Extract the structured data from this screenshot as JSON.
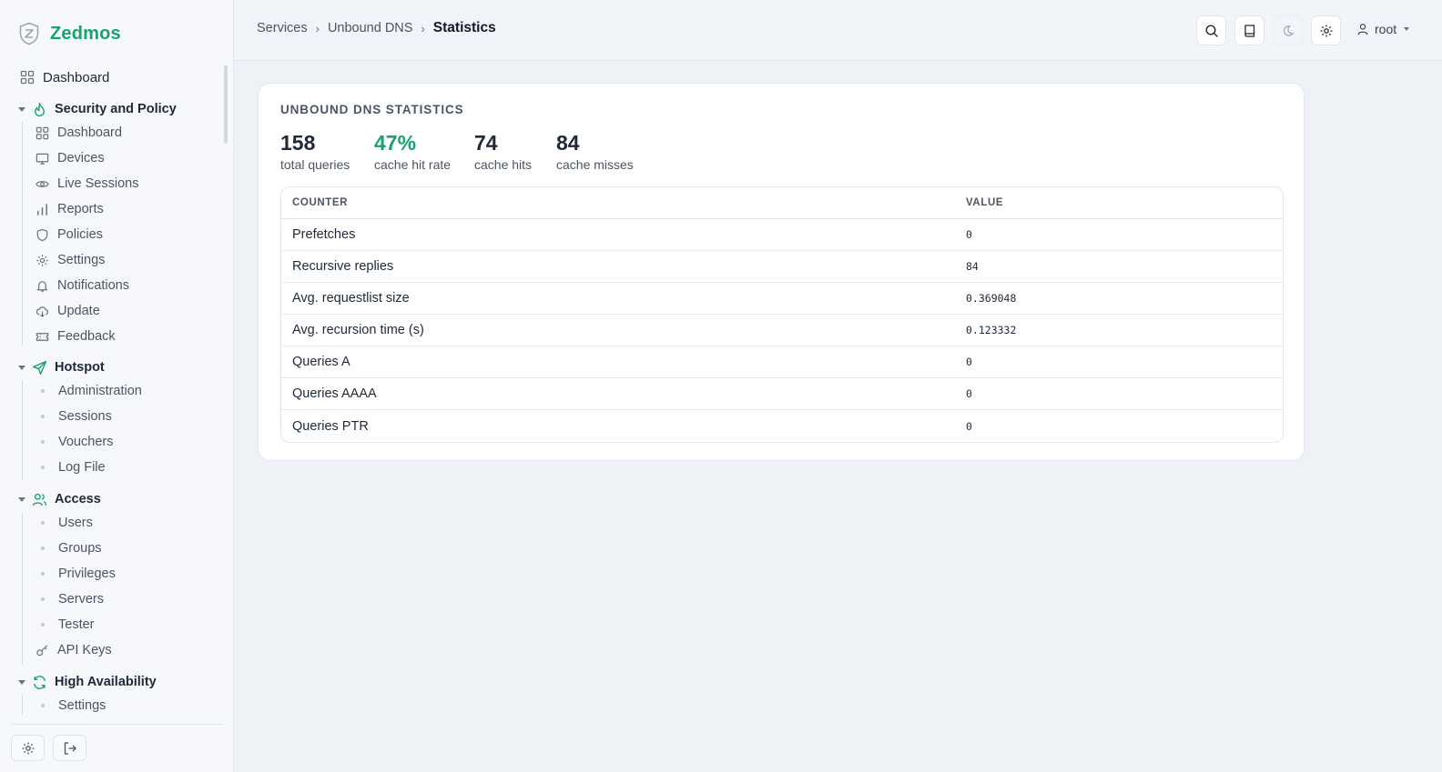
{
  "brand": {
    "name": "Zedmos",
    "color": "#16a36c"
  },
  "sidebar": {
    "dashboard_label": "Dashboard",
    "sections": [
      {
        "label": "Security and Policy",
        "icon": "flame-icon",
        "items": [
          {
            "label": "Dashboard",
            "icon": "grid-icon"
          },
          {
            "label": "Devices",
            "icon": "monitor-icon"
          },
          {
            "label": "Live Sessions",
            "icon": "eye-icon"
          },
          {
            "label": "Reports",
            "icon": "bar-chart-icon"
          },
          {
            "label": "Policies",
            "icon": "shield-icon"
          },
          {
            "label": "Settings",
            "icon": "gear-icon"
          },
          {
            "label": "Notifications",
            "icon": "bell-icon"
          },
          {
            "label": "Update",
            "icon": "cloud-download-icon"
          },
          {
            "label": "Feedback",
            "icon": "ticket-icon"
          }
        ]
      },
      {
        "label": "Hotspot",
        "icon": "send-icon",
        "items": [
          {
            "label": "Administration"
          },
          {
            "label": "Sessions"
          },
          {
            "label": "Vouchers"
          },
          {
            "label": "Log File"
          }
        ]
      },
      {
        "label": "Access",
        "icon": "users-icon",
        "items": [
          {
            "label": "Users"
          },
          {
            "label": "Groups"
          },
          {
            "label": "Privileges"
          },
          {
            "label": "Servers"
          },
          {
            "label": "Tester"
          },
          {
            "label": "API Keys",
            "icon": "key-icon"
          }
        ]
      },
      {
        "label": "High Availability",
        "icon": "refresh-icon",
        "items": [
          {
            "label": "Settings"
          }
        ]
      }
    ]
  },
  "breadcrumb": {
    "items": [
      "Services",
      "Unbound DNS"
    ],
    "current": "Statistics"
  },
  "topbar": {
    "user": "root"
  },
  "card": {
    "title": "UNBOUND DNS STATISTICS",
    "stats": [
      {
        "value": "158",
        "caption": "total queries"
      },
      {
        "value": "47%",
        "caption": "cache hit rate"
      },
      {
        "value": "74",
        "caption": "cache hits"
      },
      {
        "value": "84",
        "caption": "cache misses"
      }
    ],
    "table": {
      "headers": [
        "COUNTER",
        "VALUE"
      ],
      "rows": [
        [
          "Prefetches",
          "0"
        ],
        [
          "Recursive replies",
          "84"
        ],
        [
          "Avg. requestlist size",
          "0.369048"
        ],
        [
          "Avg. recursion time (s)",
          "0.123332"
        ],
        [
          "Queries A",
          "0"
        ],
        [
          "Queries AAAA",
          "0"
        ],
        [
          "Queries PTR",
          "0"
        ]
      ]
    }
  }
}
